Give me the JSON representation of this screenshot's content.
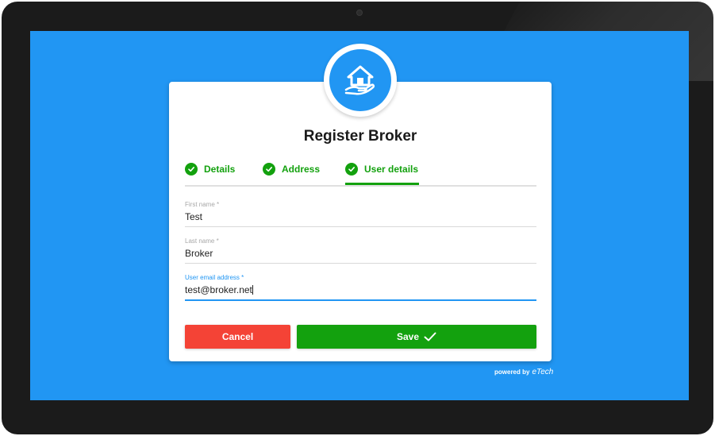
{
  "form": {
    "title": "Register Broker",
    "steps": [
      {
        "label": "Details"
      },
      {
        "label": "Address"
      },
      {
        "label": "User details"
      }
    ],
    "fields": [
      {
        "label": "First name *",
        "value": "Test"
      },
      {
        "label": "Last name *",
        "value": "Broker"
      },
      {
        "label": "User email address *",
        "value": "test@broker.net"
      }
    ],
    "cancel_label": "Cancel",
    "save_label": "Save"
  },
  "footer": {
    "powered_by": "powered by",
    "brand": "eTech"
  },
  "colors": {
    "screen_bg": "#2196f3",
    "success": "#13a10e",
    "danger": "#f44336",
    "focus": "#2196f3"
  },
  "icons": {
    "logo": "house-in-hand-icon",
    "step_check": "check-circle-icon",
    "save": "checkmark-icon"
  }
}
